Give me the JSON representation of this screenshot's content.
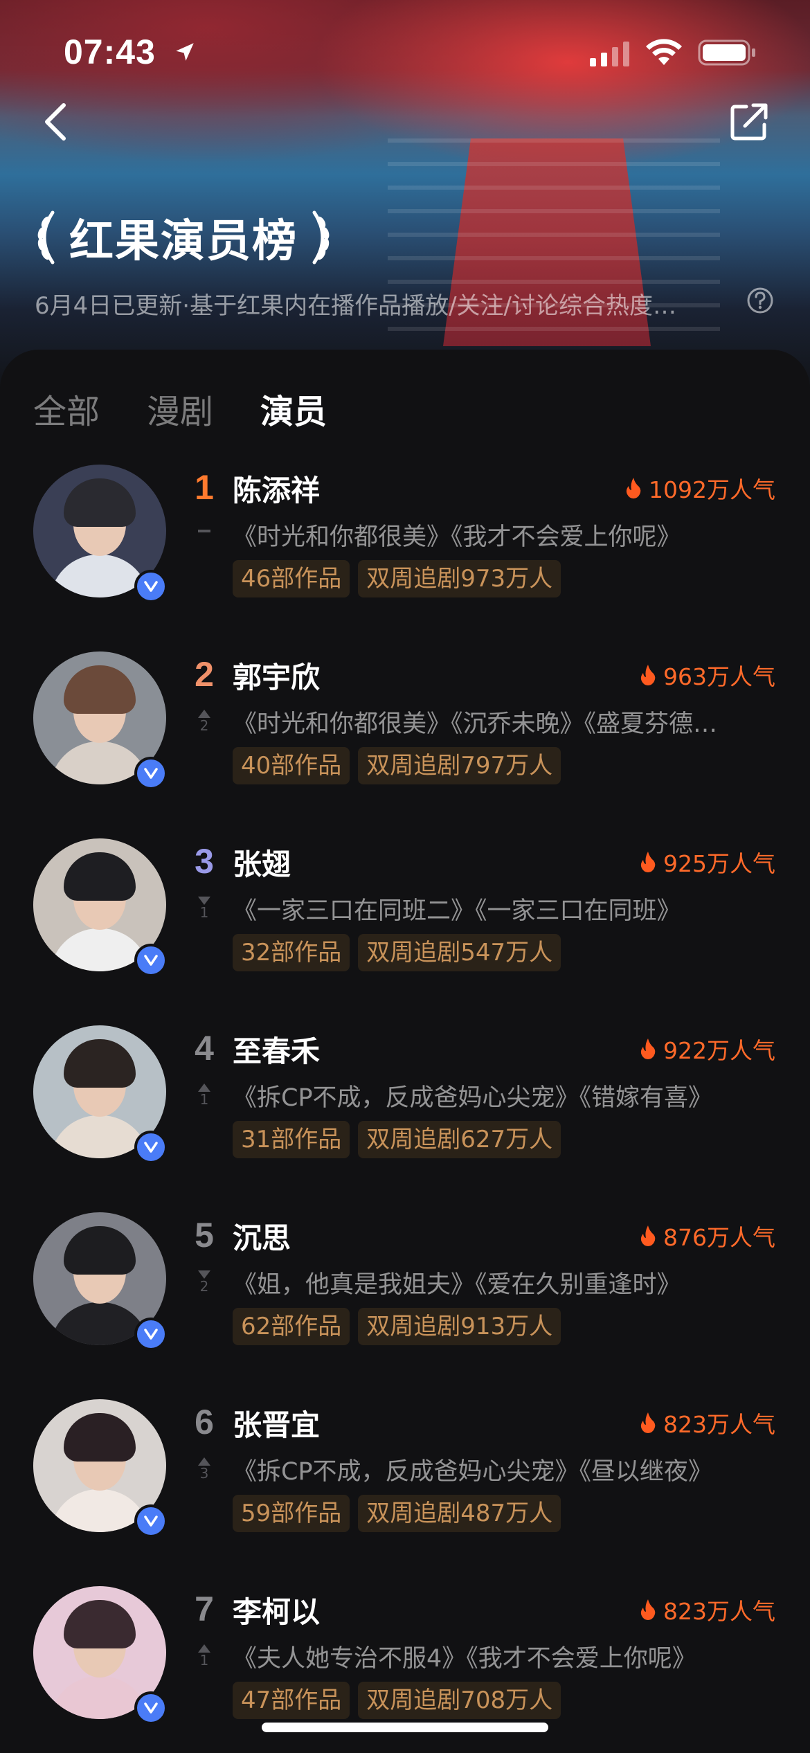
{
  "status_bar": {
    "time": "07:43"
  },
  "header": {
    "title": "红果演员榜",
    "subtitle": "6月4日已更新·基于红果内在播作品播放/关注/讨论综合热度…"
  },
  "tabs": [
    {
      "label": "全部",
      "active": false
    },
    {
      "label": "漫剧",
      "active": false
    },
    {
      "label": "演员",
      "active": true
    }
  ],
  "actors": [
    {
      "rank": "1",
      "rank_color": "#ff7a2e",
      "change": "flat",
      "change_value": "",
      "name": "陈添祥",
      "popularity": "1092万人气",
      "works": "《时光和你都很美》《我才不会爱上你呢》",
      "works_count": "46部作品",
      "followers": "双周追剧973万人",
      "hair": "#2a2a30",
      "body": "#dfe3ea",
      "bg": "#3a3f55"
    },
    {
      "rank": "2",
      "rank_color": "#f0916a",
      "change": "up",
      "change_value": "2",
      "name": "郭宇欣",
      "popularity": "963万人气",
      "works": "《时光和你都很美》《沉乔未晚》《盛夏芬德…",
      "works_count": "40部作品",
      "followers": "双周追剧797万人",
      "hair": "#6b4a3a",
      "body": "#d9d0c8",
      "bg": "#8a8f96"
    },
    {
      "rank": "3",
      "rank_color": "#9a9ae8",
      "change": "down",
      "change_value": "1",
      "name": "张翅",
      "popularity": "925万人气",
      "works": "《一家三口在同班二》《一家三口在同班》",
      "works_count": "32部作品",
      "followers": "双周追剧547万人",
      "hair": "#1e1e22",
      "body": "#efefef",
      "bg": "#c9c2bb"
    },
    {
      "rank": "4",
      "rank_color": "#8a8a8e",
      "change": "up",
      "change_value": "1",
      "name": "至春禾",
      "popularity": "922万人气",
      "works": "《拆CP不成，反成爸妈心尖宠》《错嫁有喜》",
      "works_count": "31部作品",
      "followers": "双周追剧627万人",
      "hair": "#2b2422",
      "body": "#e6dcd2",
      "bg": "#b7c0c6"
    },
    {
      "rank": "5",
      "rank_color": "#8a8a8e",
      "change": "down",
      "change_value": "2",
      "name": "沉思",
      "popularity": "876万人气",
      "works": "《姐，他真是我姐夫》《爱在久别重逢时》",
      "works_count": "62部作品",
      "followers": "双周追剧913万人",
      "hair": "#1d1d20",
      "body": "#202024",
      "bg": "#7e8088"
    },
    {
      "rank": "6",
      "rank_color": "#8a8a8e",
      "change": "up",
      "change_value": "3",
      "name": "张晋宜",
      "popularity": "823万人气",
      "works": "《拆CP不成，反成爸妈心尖宠》《昼以继夜》",
      "works_count": "59部作品",
      "followers": "双周追剧487万人",
      "hair": "#2a2024",
      "body": "#f1e9e4",
      "bg": "#d8d3d0"
    },
    {
      "rank": "7",
      "rank_color": "#8a8a8e",
      "change": "up",
      "change_value": "1",
      "name": "李柯以",
      "popularity": "823万人气",
      "works": "《夫人她专治不服4》《我才不会爱上你呢》",
      "works_count": "47部作品",
      "followers": "双周追剧708万人",
      "hair": "#3a2a30",
      "body": "#e9c7d3",
      "bg": "#e7c9d8"
    }
  ],
  "colors": {
    "accent": "#ff6a2a",
    "tag_bg": "#2a2218",
    "tag_text": "#c9935a",
    "verified": "#4a7cf7"
  }
}
